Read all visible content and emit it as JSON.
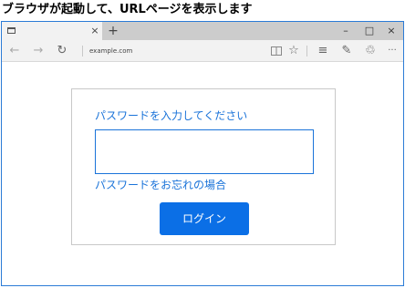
{
  "caption": "ブラウザが起動して、URLページを表示します",
  "tab": {
    "close_glyph": "×",
    "new_tab_glyph": "+"
  },
  "window_controls": {
    "minimize": "–",
    "maximize": "□",
    "close": "×"
  },
  "toolbar": {
    "back_glyph": "←",
    "forward_glyph": "→",
    "refresh_glyph": "↻",
    "url": "example.com",
    "reading_view_glyph": "📖",
    "favorite_glyph": "☆",
    "hub_glyph": "≡",
    "note_glyph": "✎",
    "share_glyph": "♲",
    "more_glyph": "···"
  },
  "form": {
    "prompt": "パスワードを入力してください",
    "password_value": "",
    "forgot_link": "パスワードをお忘れの場合",
    "login_button": "ログイン"
  },
  "colors": {
    "accent": "#1a73d9",
    "button": "#0b6fe6",
    "window_border": "#2b7bd6"
  }
}
